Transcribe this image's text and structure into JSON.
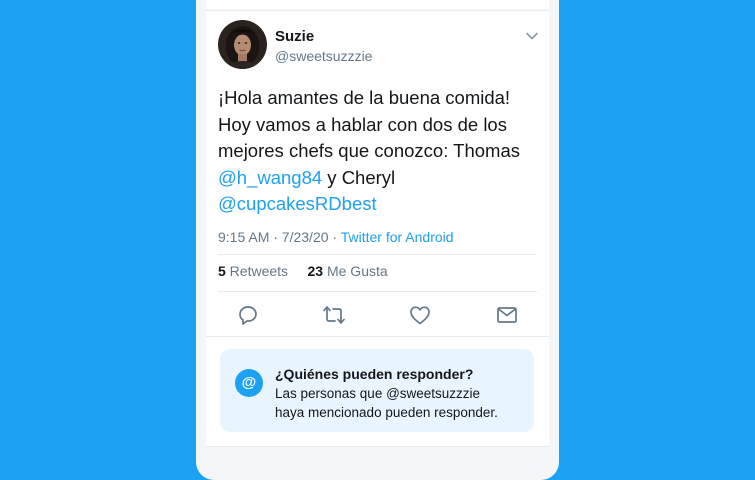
{
  "tweet": {
    "author_name": "Suzie",
    "author_handle": "@sweetsuzzzie",
    "text_line1": "¡Hola amantes de la buena comida!",
    "text_line2": "Hoy vamos a hablar con dos de los",
    "text_line3": "mejores chefs que conozco: Thomas",
    "mention1": "@h_wang84",
    "text_and": " y Cheryl",
    "mention2": "@cupcakesRDbest",
    "time": "9:15 AM · 7/23/20 · ",
    "source": "Twitter for Android",
    "retweets_count": "5",
    "retweets_label": " Retweets",
    "likes_count": "23",
    "likes_label": " Me Gusta"
  },
  "reply_restriction": {
    "icon_glyph": "@",
    "title": "¿Quiénes pueden responder?",
    "body_line1": "Las personas que  @sweetsuzzzie",
    "body_line2": "haya mencionado pueden responder."
  },
  "colors": {
    "background": "#1da1f2",
    "accent": "#1da1f2",
    "text": "#14171a",
    "muted": "#657786"
  }
}
